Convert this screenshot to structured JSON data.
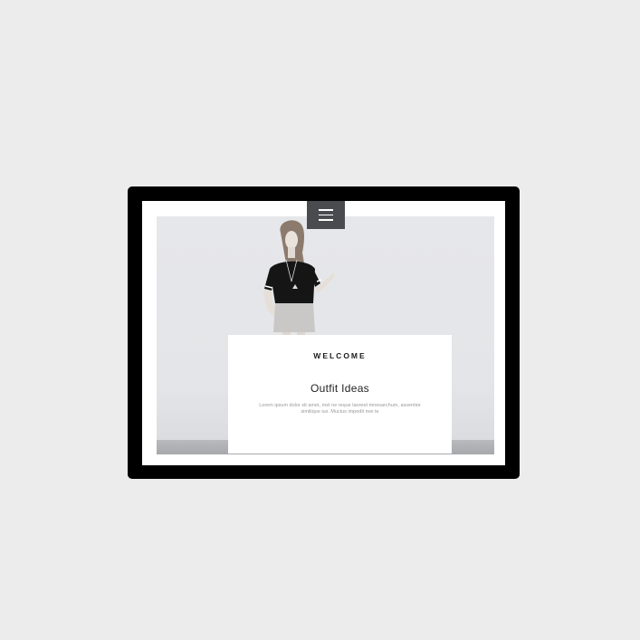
{
  "page": {
    "background_color": "#ececec",
    "device_color": "#000000",
    "accent_color": "#4a4b4f"
  },
  "header": {
    "menu_icon": "hamburger-menu-icon"
  },
  "hero": {
    "image_description_icon": "woman-portrait-image"
  },
  "welcome": {
    "heading": "WELCOME",
    "title": "Outfit Ideas",
    "body": "Lorem ipsum dolor sit amet, mel ne reque laoreet mnesarchum, assentior similique ius. Mucius impedit mei te"
  }
}
